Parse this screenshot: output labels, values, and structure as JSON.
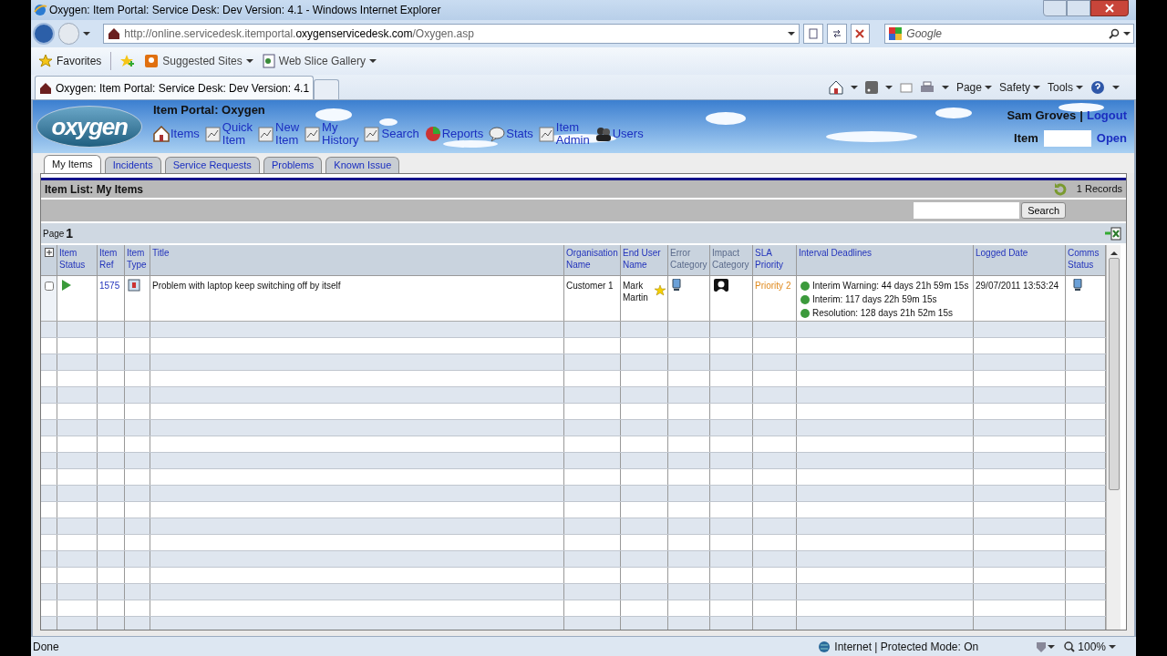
{
  "window": {
    "title": "Oxygen: Item Portal: Service Desk: Dev Version: 4.1 - Windows Internet Explorer"
  },
  "address_bar": {
    "prefix": "http://online.servicedesk.itemportal.",
    "domain": "oxygenservicedesk.com",
    "suffix": "/Oxygen.asp"
  },
  "search_box": {
    "placeholder": "Google"
  },
  "favorites_bar": {
    "favorites": "Favorites",
    "links": [
      "Suggested Sites",
      "Web Slice Gallery"
    ]
  },
  "browser_tab": {
    "title": "Oxygen: Item Portal: Service Desk: Dev Version: 4.1"
  },
  "command_bar": [
    "Page",
    "Safety",
    "Tools"
  ],
  "portal": {
    "logo": "oxygen",
    "title": "Item Portal: Oxygen",
    "nav": [
      {
        "label": "Items",
        "kind": "home"
      },
      {
        "label": "Quick Item",
        "kind": "doc"
      },
      {
        "label": "New Item",
        "kind": "doc"
      },
      {
        "label": "My History",
        "kind": "doc"
      },
      {
        "label": "Search",
        "kind": "doc"
      },
      {
        "label": "Reports",
        "kind": "chart"
      },
      {
        "label": "Stats",
        "kind": "bubble"
      },
      {
        "label": "Item Admin",
        "kind": "doc"
      },
      {
        "label": "Users",
        "kind": "users"
      }
    ],
    "user": "Sam Groves",
    "separator": "|",
    "logout": "Logout",
    "item_label": "Item",
    "open": "Open"
  },
  "tabs": [
    {
      "label": "My Items",
      "selected": true
    },
    {
      "label": "Incidents",
      "selected": false
    },
    {
      "label": "Service Requests",
      "selected": false
    },
    {
      "label": "Problems",
      "selected": false
    },
    {
      "label": "Known Issue",
      "selected": false
    }
  ],
  "item_list": {
    "title": "Item List: My Items",
    "records": "1 Records",
    "search_button": "Search",
    "page_label": "Page",
    "page": "1",
    "columns": [
      {
        "label": "Item Status",
        "sortable": true
      },
      {
        "label": "Item Ref",
        "sortable": true
      },
      {
        "label": "Item Type",
        "sortable": true
      },
      {
        "label": "Title",
        "sortable": true
      },
      {
        "label": "Organisation Name",
        "sortable": true
      },
      {
        "label": "End User Name",
        "sortable": true
      },
      {
        "label": "Error Category",
        "sortable": false
      },
      {
        "label": "Impact Category",
        "sortable": false
      },
      {
        "label": "SLA Priority",
        "sortable": true
      },
      {
        "label": "Interval Deadlines",
        "sortable": true
      },
      {
        "label": "Logged Date",
        "sortable": true
      },
      {
        "label": "Comms Status",
        "sortable": true
      }
    ],
    "rows": [
      {
        "checked": false,
        "ref": "1575",
        "title": "Problem with laptop keep switching off by itself",
        "organisation": "Customer 1",
        "end_user": "Mark Martin",
        "sla_priority": "Priority 2",
        "deadlines": [
          {
            "text": "Interim Warning: 44 days 21h 59m 15s",
            "color": "#3c9a3c"
          },
          {
            "text": "Interim: 117 days 22h 59m 15s",
            "color": "#3c9a3c"
          },
          {
            "text": "Resolution: 128 days 21h 52m 15s",
            "color": "#3c9a3c"
          }
        ],
        "logged_date": "29/07/2011 13:53:24"
      }
    ]
  },
  "status_bar": {
    "text": "Done",
    "zone": "Internet | Protected Mode: On",
    "zoom": "100%"
  }
}
